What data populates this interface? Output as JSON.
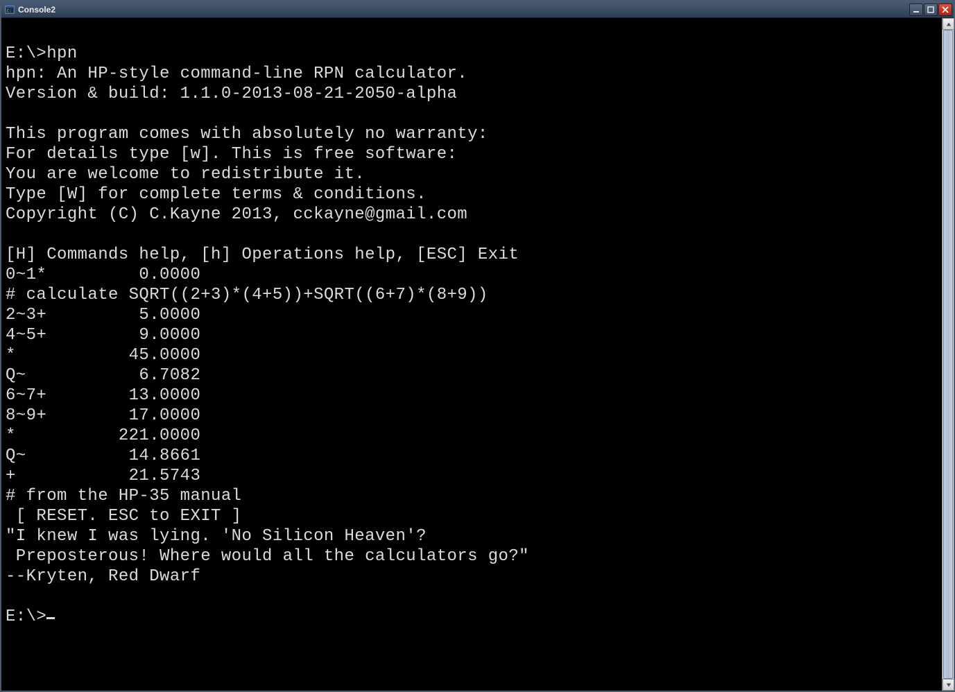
{
  "window": {
    "title": "Console2"
  },
  "terminal": {
    "lines": [
      "",
      "E:\\>hpn",
      "hpn: An HP-style command-line RPN calculator.",
      "Version & build: 1.1.0-2013-08-21-2050-alpha",
      "",
      "This program comes with absolutely no warranty:",
      "For details type [w]. This is free software:",
      "You are welcome to redistribute it.",
      "Type [W] for complete terms & conditions.",
      "Copyright (C) C.Kayne 2013, cckayne@gmail.com",
      "",
      "[H] Commands help, [h] Operations help, [ESC] Exit",
      "0~1*         0.0000",
      "# calculate SQRT((2+3)*(4+5))+SQRT((6+7)*(8+9))",
      "2~3+         5.0000",
      "4~5+         9.0000",
      "*           45.0000",
      "Q~           6.7082",
      "6~7+        13.0000",
      "8~9+        17.0000",
      "*          221.0000",
      "Q~          14.8661",
      "+           21.5743",
      "# from the HP-35 manual",
      " [ RESET. ESC to EXIT ]",
      "\"I knew I was lying. 'No Silicon Heaven'?",
      " Preposterous! Where would all the calculators go?\"",
      "--Kryten, Red Dwarf",
      "",
      "E:\\>"
    ]
  }
}
